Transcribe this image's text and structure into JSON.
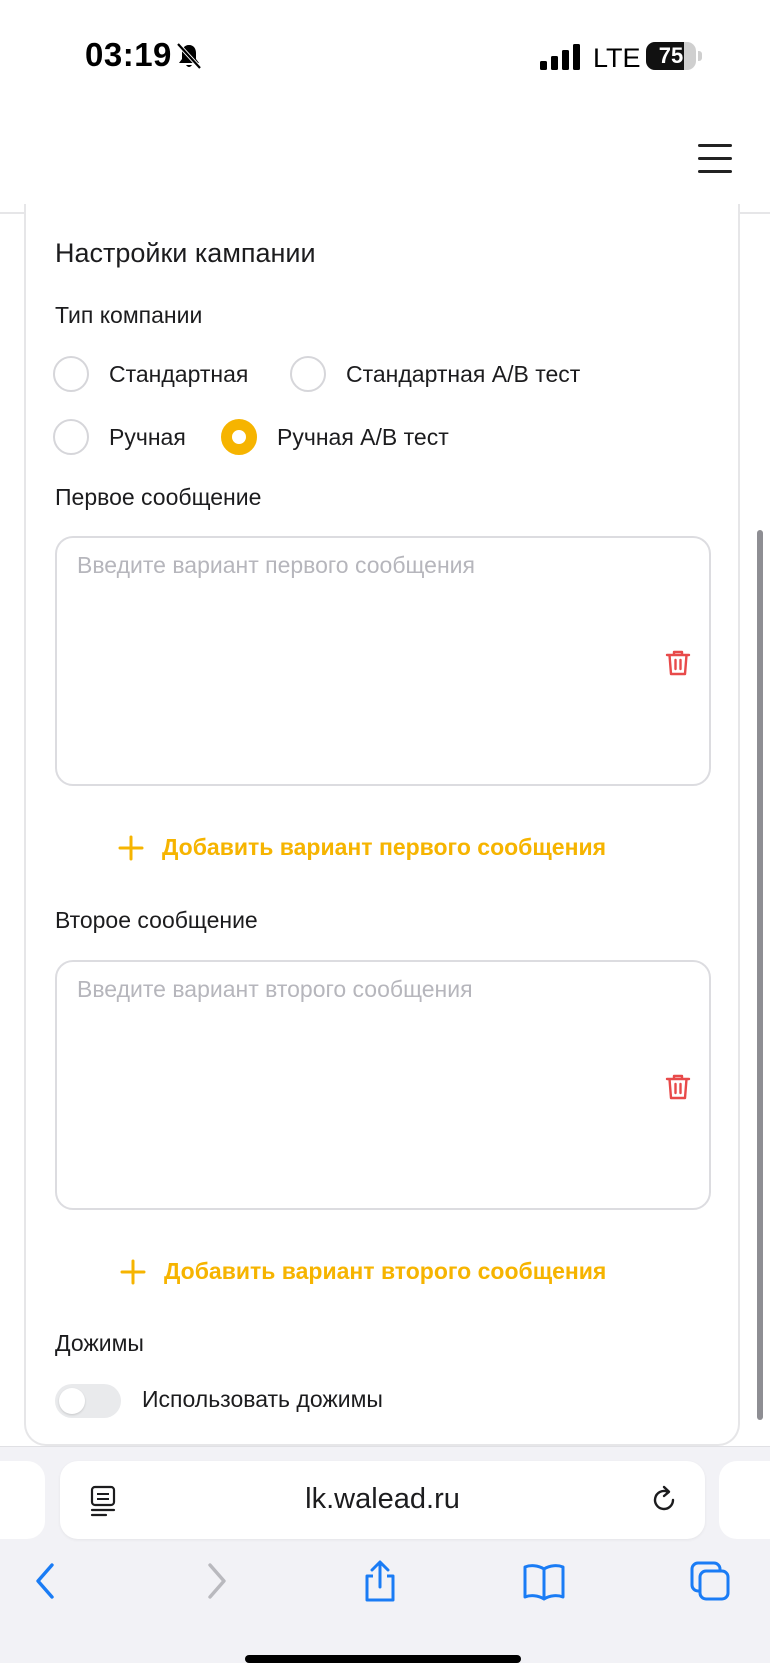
{
  "status_bar": {
    "time": "03:19",
    "network": "LTE",
    "battery": "75",
    "battery_fraction": 0.75,
    "icons": [
      "bell-slash-icon",
      "signal-bars-icon",
      "battery-icon"
    ]
  },
  "header": {
    "menu_icon": "hamburger-icon"
  },
  "campaign": {
    "title": "Настройки кампании",
    "type_label": "Тип компании",
    "types": [
      {
        "label": "Стандартная",
        "selected": false
      },
      {
        "label": "Стандартная A/B тест",
        "selected": false
      },
      {
        "label": "Ручная",
        "selected": false
      },
      {
        "label": "Ручная A/B тест",
        "selected": true
      }
    ],
    "first_message": {
      "label": "Первое сообщение",
      "placeholder": "Введите вариант первого сообщения",
      "value": "",
      "add_label": "Добавить вариант первого сообщения"
    },
    "second_message": {
      "label": "Второе сообщение",
      "placeholder": "Введите вариант второго сообщения",
      "value": "",
      "add_label": "Добавить вариант второго сообщения"
    },
    "followups": {
      "label": "Дожимы",
      "toggle_label": "Использовать дожимы",
      "enabled": false
    }
  },
  "browser": {
    "url": "lk.walead.ru",
    "icons": [
      "reader-mode-icon",
      "reload-icon",
      "back-chevron-icon",
      "forward-chevron-icon",
      "share-icon",
      "bookmarks-icon",
      "tabs-icon"
    ]
  },
  "colors": {
    "accent": "#f6b400",
    "danger": "#e84a4a",
    "ios_blue": "#1a7cf5",
    "border": "#dcdce0",
    "placeholder": "#b6b6bc"
  }
}
